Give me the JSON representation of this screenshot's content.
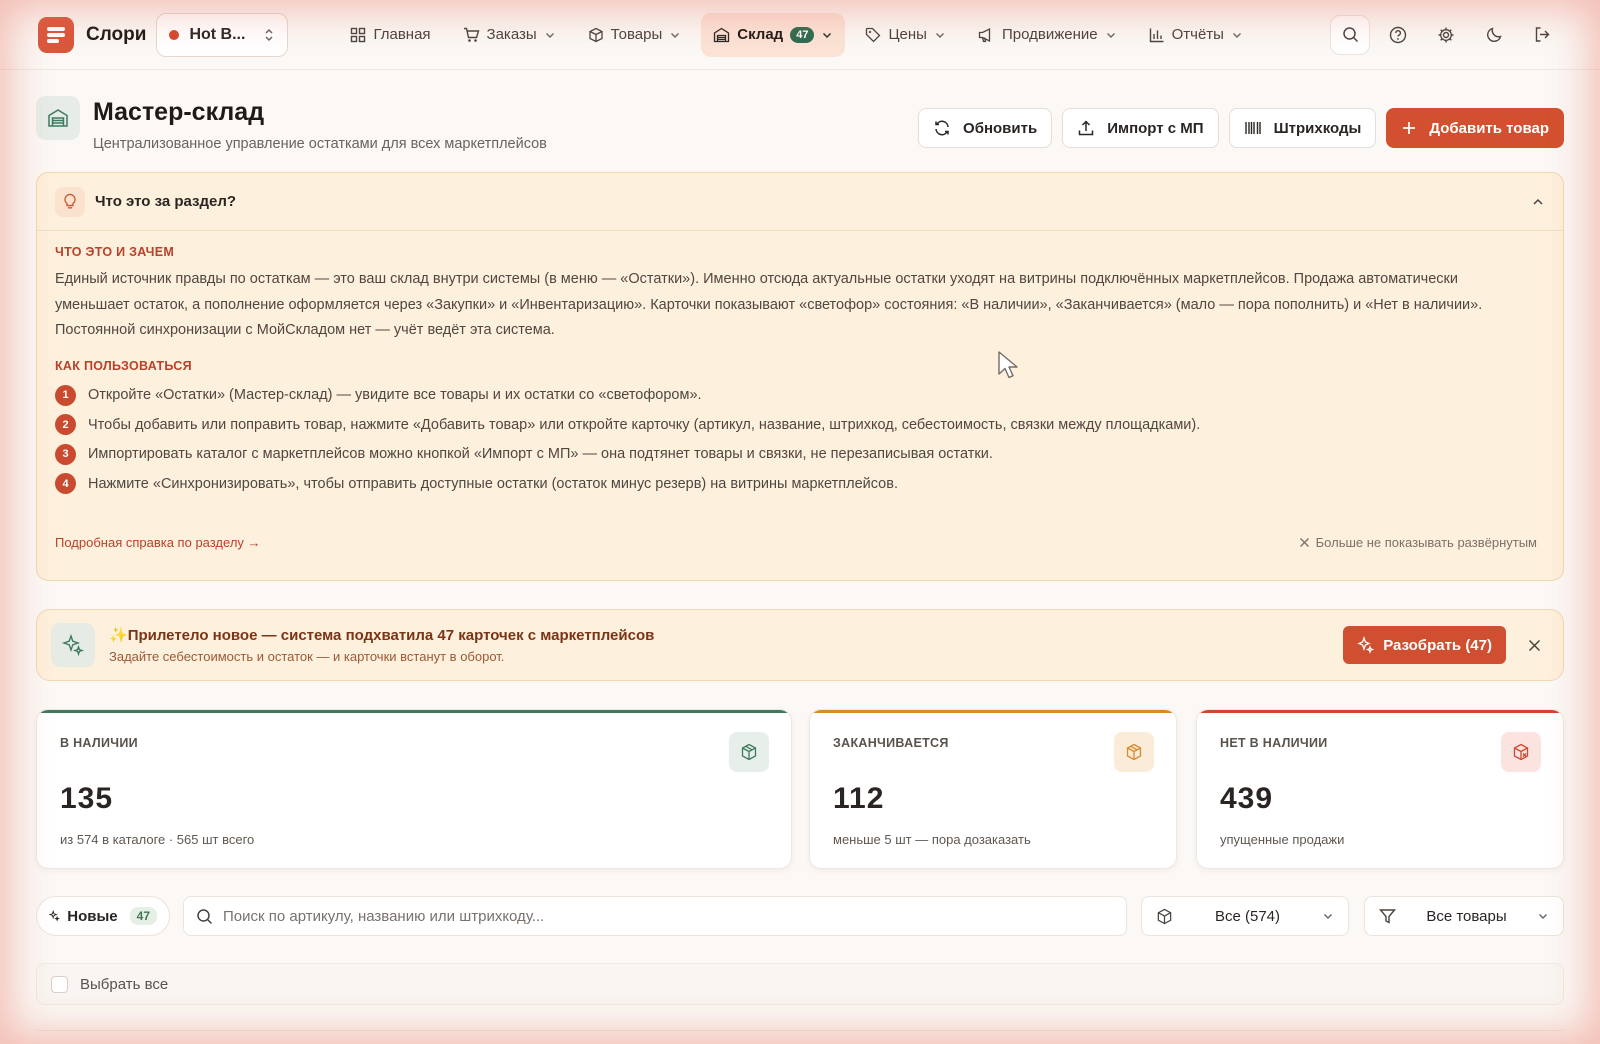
{
  "brand": "Слори",
  "store_selector": {
    "value": "Hot B..."
  },
  "nav": [
    {
      "id": "home",
      "label": "Главная",
      "icon": "grid-icon",
      "has_menu": false
    },
    {
      "id": "orders",
      "label": "Заказы",
      "icon": "cart-icon",
      "has_menu": true
    },
    {
      "id": "products",
      "label": "Товары",
      "icon": "box-icon",
      "has_menu": true
    },
    {
      "id": "warehouse",
      "label": "Склад",
      "icon": "warehouse-icon",
      "badge": "47",
      "has_menu": true,
      "active": true
    },
    {
      "id": "prices",
      "label": "Цены",
      "icon": "tag-icon",
      "has_menu": true
    },
    {
      "id": "promotion",
      "label": "Продвижение",
      "icon": "megaphone-icon",
      "has_menu": true
    },
    {
      "id": "reports",
      "label": "Отчёты",
      "icon": "bar-chart-icon",
      "has_menu": true
    }
  ],
  "header": {
    "title": "Мастер-склад",
    "subtitle": "Централизованное управление остатками для всех маркетплейсов",
    "buttons": {
      "refresh": "Обновить",
      "import": "Импорт с МП",
      "barcodes": "Штрихкоды",
      "add": "Добавить товар"
    }
  },
  "info": {
    "question": "Что это за раздел?",
    "what_title": "ЧТО ЭТО И ЗАЧЕМ",
    "what_text": "Единый источник правды по остаткам — это ваш склад внутри системы (в меню — «Остатки»). Именно отсюда актуальные остатки уходят на витрины подключённых маркетплейсов. Продажа автоматически уменьшает остаток, а пополнение оформляется через «Закупки» и «Инвентаризацию». Карточки показывают «светофор» состояния: «В наличии», «Заканчивается» (мало — пора пополнить) и «Нет в наличии». Постоянной синхронизации с МойСкладом нет — учёт ведёт эта система.",
    "how_title": "КАК ПОЛЬЗОВАТЬСЯ",
    "steps": [
      {
        "num": "1",
        "text": "Откройте «Остатки» (Мастер-склад) — увидите все товары и их остатки со «светофором»."
      },
      {
        "num": "2",
        "text": "Чтобы добавить или поправить товар, нажмите «Добавить товар» или откройте карточку (артикул, название, штрихкод, себестоимость, связки между площадками)."
      },
      {
        "num": "3",
        "text": "Импортировать каталог с маркетплейсов можно кнопкой «Импорт с МП» — она подтянет товары и связки, не перезаписывая остатки."
      },
      {
        "num": "4",
        "text": "Нажмите «Синхронизировать», чтобы отправить доступные остатки (остаток минус резерв) на витрины маркетплейсов."
      }
    ],
    "more_link": "Подробная справка по разделу →",
    "hide_expanded": "Больше не показывать развёрнутым"
  },
  "banner": {
    "star": "✨",
    "title": "Прилетело новое — система подхватила 47 карточек с маркетплейсов",
    "subtitle": "Задайте себестоимость и остаток — и карточки встанут в оборот.",
    "button": "Разобрать (47)"
  },
  "kpis": [
    {
      "id": "in-stock",
      "label": "В НАЛИЧИИ",
      "value": "135",
      "note": "из 574 в каталоге · 565 шт всего",
      "accent": "#3f7a5e",
      "icon_bg": "#e7efea",
      "icon_color": "#3f7a5e"
    },
    {
      "id": "running-low",
      "label": "ЗАКАНЧИВАЕТСЯ",
      "value": "112",
      "note": "меньше 5 шт — пора дозаказать",
      "accent": "#d98a2b",
      "icon_bg": "#fbecd9",
      "icon_color": "#d98a2b"
    },
    {
      "id": "out-of-stock",
      "label": "НЕТ В НАЛИЧИИ",
      "value": "439",
      "note": "упущенные продажи",
      "accent": "#d2452f",
      "icon_bg": "#fbe4e0",
      "icon_color": "#d2452f"
    }
  ],
  "filters": {
    "new_chip": {
      "label": "Новые",
      "count": "47"
    },
    "search_placeholder": "Поиск по артикулу, названию или штрихкоду...",
    "stock_select": "Все (574)",
    "product_select": "Все товары"
  },
  "select_all": "Выбрать все",
  "colors": {
    "accent": "#d2502f",
    "success": "#2f6b4f",
    "info_bg": "#fdf0dc"
  }
}
